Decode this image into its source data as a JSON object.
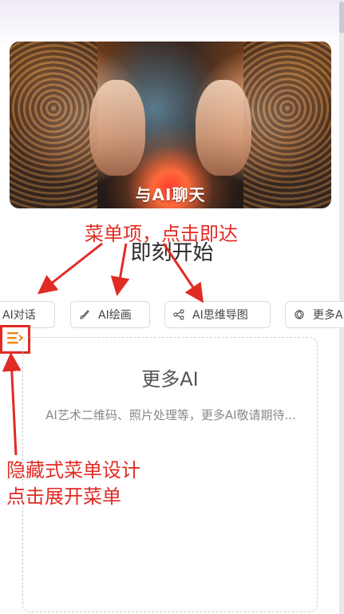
{
  "banner": {
    "label": "与AI聊天"
  },
  "annotations": {
    "top": "菜单项，点击即达",
    "bottom_line1": "隐藏式菜单设计",
    "bottom_line2": "点击展开菜单"
  },
  "headline": "即刻开始",
  "tabs": [
    {
      "label": "AI对话",
      "icon": "chat-icon"
    },
    {
      "label": "AI绘画",
      "icon": "brush-icon"
    },
    {
      "label": "AI思维导图",
      "icon": "mindmap-icon"
    },
    {
      "label": "更多AI",
      "icon": "openai-icon"
    }
  ],
  "menu_toggle": {
    "icon": "menu-toggle-icon",
    "color": "#f08a1c"
  },
  "card": {
    "title": "更多AI",
    "description": "AI艺术二维码、照片处理等，更多AI敬请期待..."
  },
  "colors": {
    "annotation": "#e12b24",
    "accent": "#f08a1c"
  }
}
